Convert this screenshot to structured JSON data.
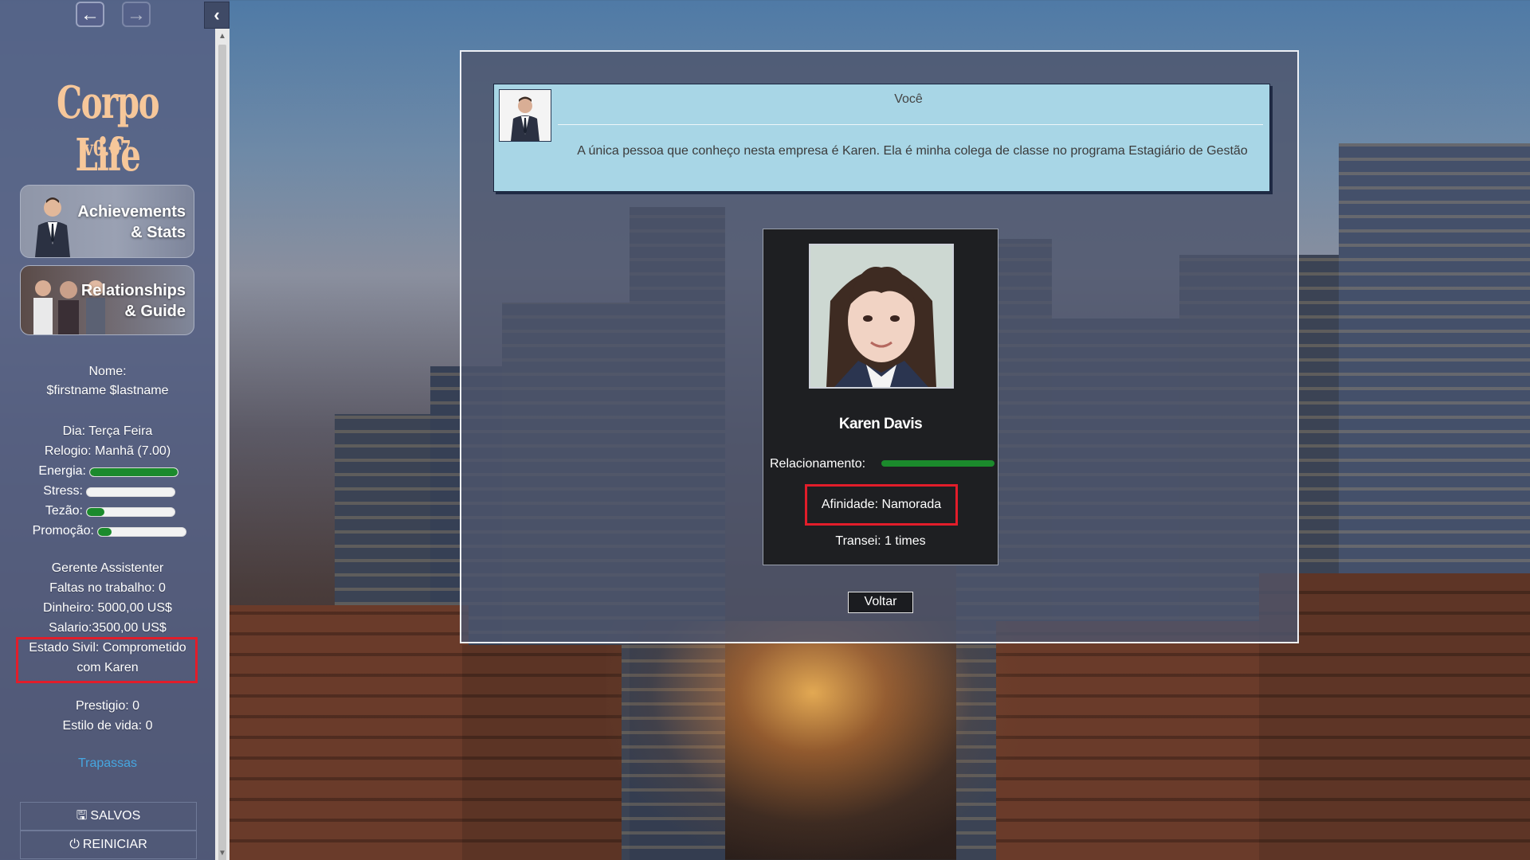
{
  "nav": {
    "back_icon": "arrow-left-icon",
    "forward_icon": "arrow-right-icon",
    "collapse_icon": "chevron-left-icon"
  },
  "sidebar": {
    "logo": "Corpo Life",
    "version": "v0.07",
    "menu": {
      "achievements_line1": "Achievements",
      "achievements_line2": "& Stats",
      "relationships_line1": "Relationships",
      "relationships_line2": "& Guide"
    },
    "nome_label": "Nome:",
    "nome_value": "$firstname $lastname",
    "dia": "Dia: Terça Feira",
    "relogio": "Relogio: Manhã (7.00)",
    "bars": [
      {
        "label": "Energia:",
        "level": 1.0
      },
      {
        "label": "Stress:",
        "level": 0.0
      },
      {
        "label": "Tezão:",
        "level": 0.2
      },
      {
        "label": "Promoção:",
        "level": 0.15
      }
    ],
    "cargo": "Gerente Assistenter",
    "faltas": "Faltas no trabalho: 0",
    "dinheiro": "Dinheiro: 5000,00 US$",
    "salario": "Salario:3500,00 US$",
    "estado_sivil_line1": "Estado Sivil: Comprometido",
    "estado_sivil_line2": "com Karen",
    "prestigio": "Prestigio: 0",
    "estilo": "Estilo de vida: 0",
    "cheats_link": "Trapassas",
    "saves_button": "SALVOS",
    "restart_button": "REINICIAR",
    "saves_icon": "floppy-disk-icon",
    "restart_icon": "power-icon"
  },
  "dialog": {
    "speaker": "Você",
    "text": "A única pessoa que conheço nesta empresa é Karen. Ela é minha colega de classe no programa Estagiário de Gestão"
  },
  "character": {
    "name": "Karen Davis",
    "relationship_label": "Relacionamento:",
    "relationship_level": 1.0,
    "affinity": "Afinidade: Namorada",
    "transei": "Transei: 1 times"
  },
  "buttons": {
    "voltar": "Voltar"
  },
  "colors": {
    "highlight": "#e21d2a",
    "bar_fill": "#1b8a2c",
    "link": "#46a6e0",
    "logo": "#f6c79a",
    "dialog_bg": "#a8d6e6"
  }
}
